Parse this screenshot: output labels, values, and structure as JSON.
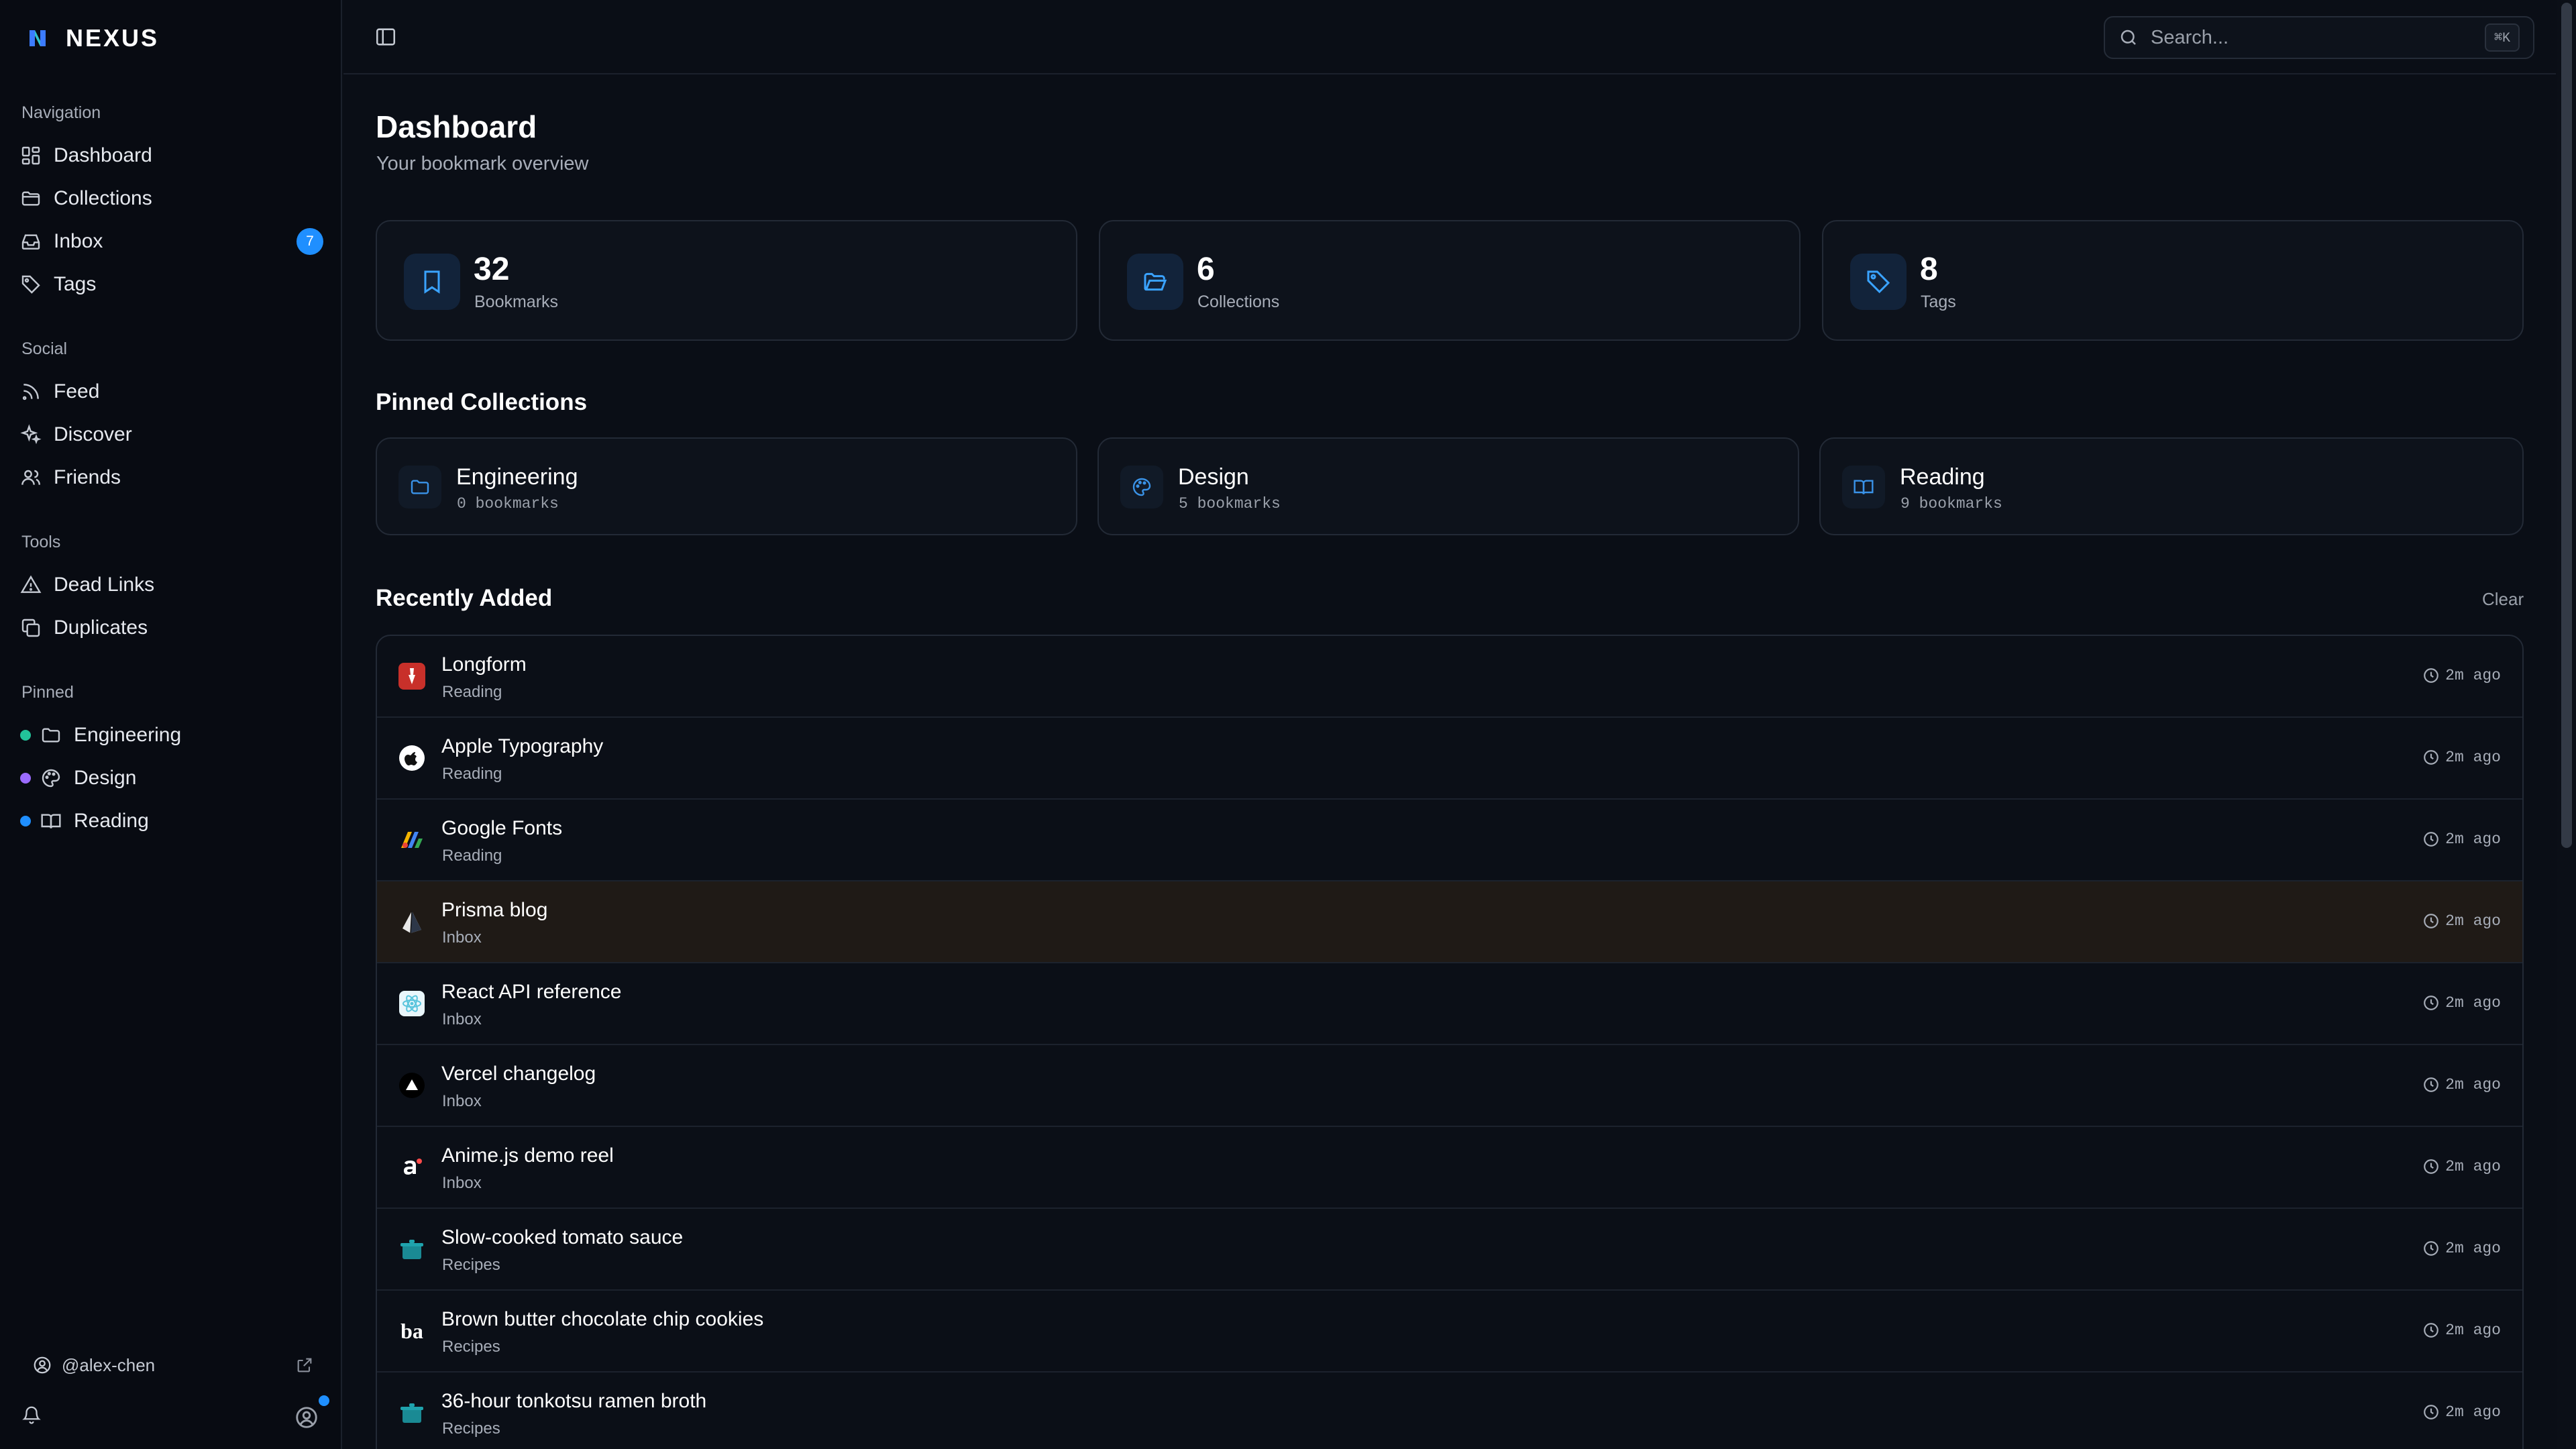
{
  "app": {
    "name": "NEXUS"
  },
  "sidebar": {
    "sections": [
      {
        "label": "Navigation",
        "items": [
          {
            "label": "Dashboard",
            "icon": "dashboard-icon"
          },
          {
            "label": "Collections",
            "icon": "folder-icon"
          },
          {
            "label": "Inbox",
            "icon": "inbox-icon",
            "badge": "7"
          },
          {
            "label": "Tags",
            "icon": "tag-icon"
          }
        ]
      },
      {
        "label": "Social",
        "items": [
          {
            "label": "Feed",
            "icon": "rss-icon"
          },
          {
            "label": "Discover",
            "icon": "sparkles-icon"
          },
          {
            "label": "Friends",
            "icon": "users-icon"
          }
        ]
      },
      {
        "label": "Tools",
        "items": [
          {
            "label": "Dead Links",
            "icon": "warning-icon"
          },
          {
            "label": "Duplicates",
            "icon": "copy-icon"
          }
        ]
      },
      {
        "label": "Pinned",
        "items": [
          {
            "label": "Engineering",
            "icon": "folder-icon",
            "dot": "#22c39a"
          },
          {
            "label": "Design",
            "icon": "palette-icon",
            "dot": "#9b6bff"
          },
          {
            "label": "Reading",
            "icon": "book-icon",
            "dot": "#1f8fff"
          }
        ]
      }
    ],
    "user": {
      "handle": "@alex-chen"
    }
  },
  "topbar": {
    "search_placeholder": "Search...",
    "search_shortcut": "⌘K"
  },
  "main": {
    "title": "Dashboard",
    "subtitle": "Your bookmark overview",
    "stats": [
      {
        "value": "32",
        "label": "Bookmarks",
        "icon": "bookmark-icon"
      },
      {
        "value": "6",
        "label": "Collections",
        "icon": "folder-open-icon"
      },
      {
        "value": "8",
        "label": "Tags",
        "icon": "tag-icon"
      }
    ],
    "pinned_title": "Pinned Collections",
    "pinned": [
      {
        "name": "Engineering",
        "count": "0 bookmarks",
        "icon": "folder-icon"
      },
      {
        "name": "Design",
        "count": "5 bookmarks",
        "icon": "palette-icon"
      },
      {
        "name": "Reading",
        "count": "9 bookmarks",
        "icon": "book-icon"
      }
    ],
    "recent_title": "Recently Added",
    "clear_label": "Clear",
    "recent": [
      {
        "title": "Longform",
        "collection": "Reading",
        "time": "2m ago",
        "favicon": "longform-favicon"
      },
      {
        "title": "Apple Typography",
        "collection": "Reading",
        "time": "2m ago",
        "favicon": "apple-favicon"
      },
      {
        "title": "Google Fonts",
        "collection": "Reading",
        "time": "2m ago",
        "favicon": "google-fonts-favicon"
      },
      {
        "title": "Prisma blog",
        "collection": "Inbox",
        "time": "2m ago",
        "favicon": "prisma-favicon"
      },
      {
        "title": "React API reference",
        "collection": "Inbox",
        "time": "2m ago",
        "favicon": "react-favicon"
      },
      {
        "title": "Vercel changelog",
        "collection": "Inbox",
        "time": "2m ago",
        "favicon": "vercel-favicon"
      },
      {
        "title": "Anime.js demo reel",
        "collection": "Inbox",
        "time": "2m ago",
        "favicon": "animejs-favicon"
      },
      {
        "title": "Slow-cooked tomato sauce",
        "collection": "Recipes",
        "time": "2m ago",
        "favicon": "pot-favicon"
      },
      {
        "title": "Brown butter chocolate chip cookies",
        "collection": "Recipes",
        "time": "2m ago",
        "favicon": "ba-favicon",
        "favicon_text": "ba"
      },
      {
        "title": "36-hour tonkotsu ramen broth",
        "collection": "Recipes",
        "time": "2m ago",
        "favicon": "pot-favicon"
      }
    ]
  },
  "colors": {
    "accent": "#1f8fff",
    "background": "#0a0e16",
    "highlight_row": "#1f1a16"
  }
}
